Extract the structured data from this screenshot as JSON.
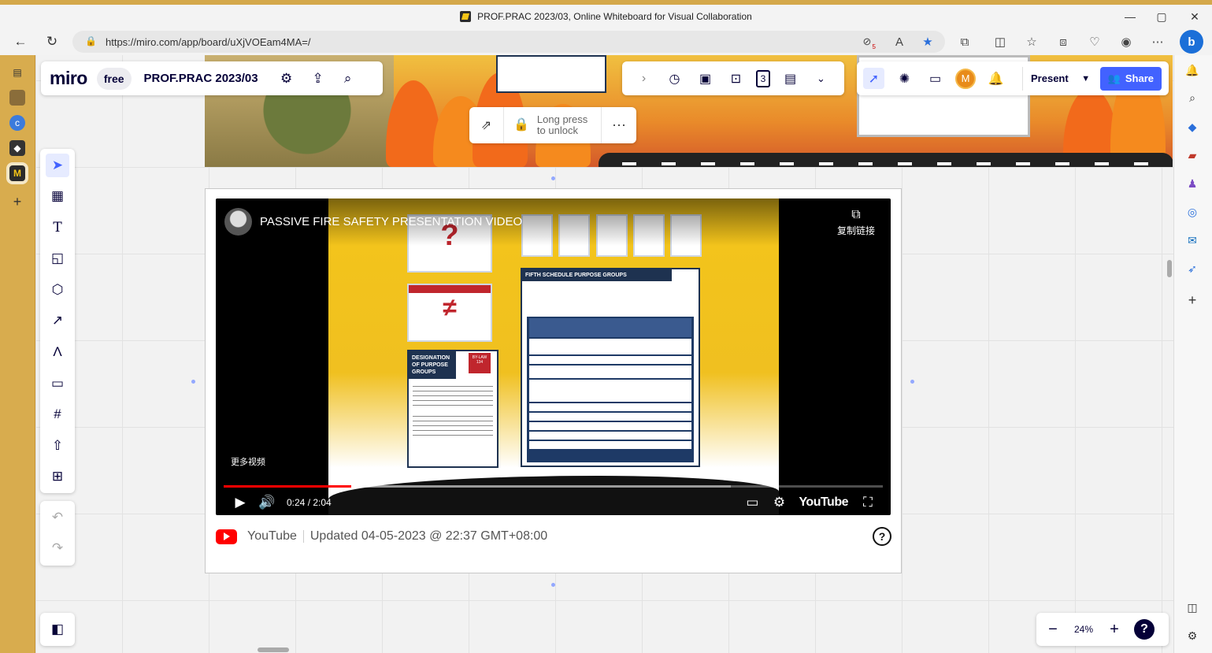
{
  "window": {
    "title": "PROF.PRAC 2023/03, Online Whiteboard for Visual Collaboration",
    "minimize": "—",
    "maximize": "▢",
    "close": "✕"
  },
  "browser": {
    "url": "https://miro.com/app/board/uXjVOEam4MA=/",
    "tracking_badge": "5"
  },
  "miro": {
    "logo": "miro",
    "plan": "free",
    "board_title": "PROF.PRAC 2023/03",
    "present_label": "Present",
    "share_label": "Share",
    "avatar_initial": "M",
    "lock_label_line1": "Long press",
    "lock_label_line2": "to unlock",
    "zoom_level": "24%",
    "help": "?",
    "frame_counter": "3"
  },
  "video": {
    "title": "PASSIVE FIRE SAFETY PRESENTATION VIDEO",
    "copy_link": "复制链接",
    "more_videos": "更多视频",
    "time": "0:24 / 2:04",
    "brand": "YouTube",
    "played_fraction": 0.194,
    "loaded_fraction": 0.77,
    "slide_purpose_header": "FIFTH SCHEDULE PURPOSE GROUPS",
    "slide_designation_header": "DESIGNATION OF PURPOSE GROUPS",
    "slide_bylaw": "BY-LAW 134"
  },
  "embed_footer": {
    "source": "YouTube",
    "updated": "Updated 04-05-2023 @ 22:37 GMT+08:00",
    "help": "?"
  },
  "colors": {
    "miro_blue": "#4262ff",
    "miro_dark": "#050038",
    "youtube_red": "#ff0000"
  }
}
